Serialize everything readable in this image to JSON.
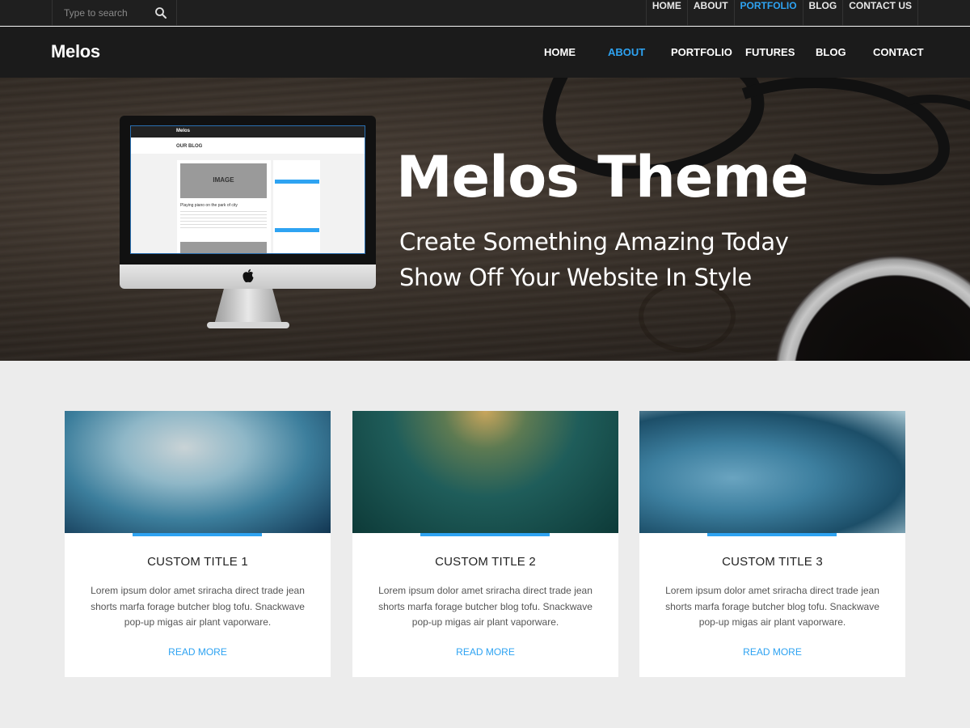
{
  "topbar": {
    "search_placeholder": "Type to search",
    "nav": [
      {
        "label": "HOME",
        "active": false
      },
      {
        "label": "ABOUT",
        "active": false
      },
      {
        "label": "PORTFOLIO",
        "active": true
      },
      {
        "label": "BLOG",
        "active": false
      },
      {
        "label": "CONTACT US",
        "active": false
      }
    ]
  },
  "header": {
    "logo": "Melos",
    "nav": [
      {
        "label": "HOME",
        "active": false
      },
      {
        "label": "ABOUT",
        "active": true
      },
      {
        "label": "PORTFOLIO",
        "active": false
      },
      {
        "label": "FUTURES",
        "active": false
      },
      {
        "label": "BLOG",
        "active": false
      },
      {
        "label": "CONTACT",
        "active": false
      }
    ]
  },
  "hero": {
    "title": "Melos Theme",
    "subtitle_line1": "Create Something Amazing Today",
    "subtitle_line2": "Show Off Your Website In Style",
    "screen": {
      "logo": "Melos",
      "page_title": "OUR BLOG",
      "image_label": "IMAGE",
      "post_title": "Playing piano on the park of city"
    }
  },
  "cards": [
    {
      "title": "CUSTOM TITLE 1",
      "text": "Lorem ipsum dolor amet sriracha direct trade jean shorts marfa forage butcher blog tofu. Snackwave pop-up migas air plant vaporware.",
      "link": "READ MORE"
    },
    {
      "title": "CUSTOM TITLE 2",
      "text": "Lorem ipsum dolor amet sriracha direct trade jean shorts marfa forage butcher blog tofu. Snackwave pop-up migas air plant vaporware.",
      "link": "READ MORE"
    },
    {
      "title": "CUSTOM TITLE 3",
      "text": "Lorem ipsum dolor amet sriracha direct trade jean shorts marfa forage butcher blog tofu. Snackwave pop-up migas air plant vaporware.",
      "link": "READ MORE"
    }
  ],
  "colors": {
    "accent": "#2ea3f2",
    "topbar_bg": "#1f1f1f",
    "header_bg": "#1b1b1b",
    "page_bg": "#ececec"
  }
}
